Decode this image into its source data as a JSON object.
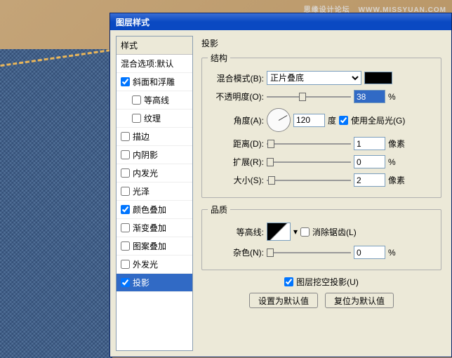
{
  "watermark": {
    "main": "思缘设计论坛",
    "sub": "WWW.MISSYUAN.COM"
  },
  "dialog": {
    "title": "图层样式"
  },
  "styles": {
    "header": "样式",
    "blendOptions": "混合选项:默认",
    "items": [
      {
        "label": "斜面和浮雕",
        "checked": true
      },
      {
        "label": "等高线",
        "checked": false,
        "sub": true
      },
      {
        "label": "纹理",
        "checked": false,
        "sub": true
      },
      {
        "label": "描边",
        "checked": false
      },
      {
        "label": "内阴影",
        "checked": false
      },
      {
        "label": "内发光",
        "checked": false
      },
      {
        "label": "光泽",
        "checked": false
      },
      {
        "label": "颜色叠加",
        "checked": true
      },
      {
        "label": "渐变叠加",
        "checked": false
      },
      {
        "label": "图案叠加",
        "checked": false
      },
      {
        "label": "外发光",
        "checked": false
      },
      {
        "label": "投影",
        "checked": true,
        "selected": true
      }
    ]
  },
  "panel": {
    "title": "投影",
    "structure": {
      "legend": "结构",
      "blendMode": {
        "label": "混合模式(B):",
        "value": "正片叠底"
      },
      "opacity": {
        "label": "不透明度(O):",
        "value": "38",
        "unit": "%"
      },
      "angle": {
        "label": "角度(A):",
        "value": "120",
        "unit": "度",
        "global": "使用全局光(G)"
      },
      "distance": {
        "label": "距离(D):",
        "value": "1",
        "unit": "像素"
      },
      "spread": {
        "label": "扩展(R):",
        "value": "0",
        "unit": "%"
      },
      "size": {
        "label": "大小(S):",
        "value": "2",
        "unit": "像素"
      }
    },
    "quality": {
      "legend": "品质",
      "contour": {
        "label": "等高线:",
        "antialias": "消除锯齿(L)"
      },
      "noise": {
        "label": "杂色(N):",
        "value": "0",
        "unit": "%"
      }
    },
    "knockout": "图层挖空投影(U)",
    "btnDefault": "设置为默认值",
    "btnReset": "复位为默认值"
  }
}
